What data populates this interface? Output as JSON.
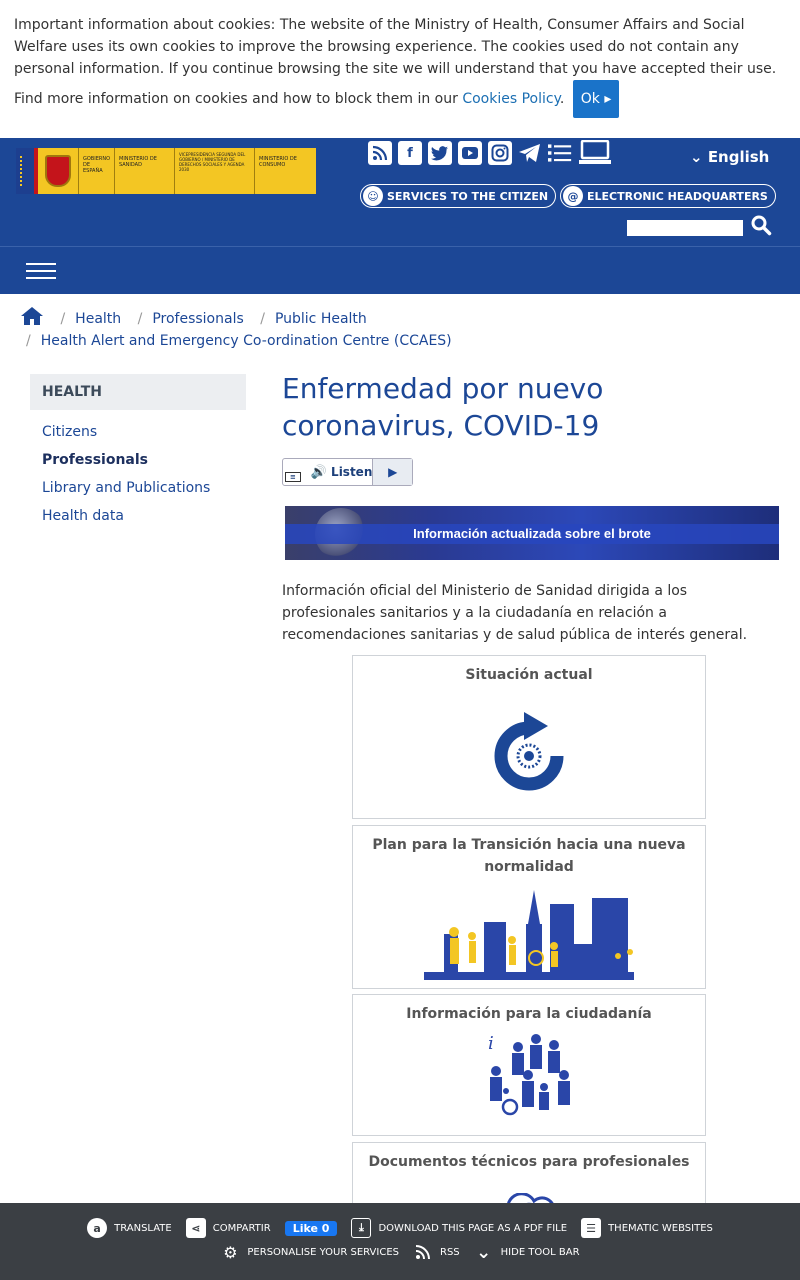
{
  "cookie": {
    "text": "Important information about cookies: The website of the Ministry of Health, Consumer Affairs and Social Welfare uses its own cookies to improve the browsing experience. The cookies used do not contain any personal information. If you continue browsing the site we will understand that you have accepted their use. Find more information on cookies and how to block them in our ",
    "link": "Cookies Policy",
    "ok": "Ok ▸"
  },
  "header": {
    "logo_lines": [
      "GOBIERNO DE ESPAÑA",
      "MINISTERIO DE SANIDAD",
      "VICEPRESIDENCIA SEGUNDA DEL GOBIERNO / MINISTERIO DE DERECHOS SOCIALES Y AGENDA 2030",
      "MINISTERIO DE CONSUMO"
    ],
    "language": "English",
    "services_label": "SERVICES TO THE CITIZEN",
    "headquarters_label": "ELECTRONIC HEADQUARTERS",
    "social_icons": [
      "rss-icon",
      "facebook-icon",
      "twitter-icon",
      "youtube-icon",
      "instagram-icon",
      "telegram-icon",
      "list-icon",
      "laptop-icon"
    ]
  },
  "breadcrumb": [
    "Health",
    "Professionals",
    "Public Health",
    "Health Alert and Emergency Co-ordination Centre (CCAES)"
  ],
  "sidebar": {
    "heading": "HEALTH",
    "items": [
      "Citizens",
      "Professionals",
      "Library and Publications",
      "Health data"
    ]
  },
  "main": {
    "title": "Enfermedad por nuevo coronavirus, COVID-19",
    "listen": "Listen",
    "banner_text": "Información actualizada sobre el brote",
    "intro": "Información oficial del Ministerio de Sanidad dirigida a los profesionales sanitarios y a la ciudadanía en relación a recomendaciones sanitarias y de salud pública de interés general.",
    "cards": [
      {
        "title": "Situación actual"
      },
      {
        "title": "Plan para la Transición hacia una nueva normalidad"
      },
      {
        "title": "Información para la ciudadanía"
      },
      {
        "title": "Documentos técnicos para profesionales"
      }
    ]
  },
  "toolbar": {
    "translate": "TRANSLATE",
    "share": "COMPARTIR",
    "fb_like": "Like 0",
    "pdf": "DOWNLOAD THIS PAGE AS A PDF FILE",
    "thematic": "THEMATIC WEBSITES",
    "personalise": "PERSONALISE YOUR SERVICES",
    "rss": "RSS",
    "hide": "HIDE TOOL BAR"
  },
  "colors": {
    "brand": "#1c4796",
    "accent": "#1a73c9",
    "toolbar": "#3b3f44",
    "logo_yellow": "#f3c623"
  }
}
